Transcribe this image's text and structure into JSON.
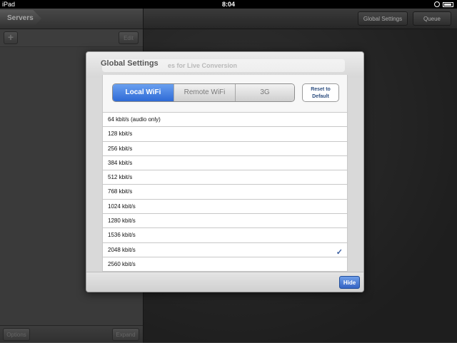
{
  "status_bar": {
    "device": "iPad",
    "time": "8:04",
    "icons": [
      "rotation-lock-icon",
      "battery-icon"
    ]
  },
  "left_pane": {
    "title": "Servers",
    "add_label": "+",
    "edit_label": "Edit",
    "options_label": "Options",
    "expand_label": "Expand"
  },
  "right_navbar": {
    "global_settings_label": "Global Settings",
    "queue_label": "Queue"
  },
  "modal": {
    "title": "Global Settings",
    "underlying_title": "es for Live Conversion",
    "segments": [
      "Local WiFi",
      "Remote WiFi",
      "3G"
    ],
    "selected_segment": "Local WiFi",
    "reset_label_line1": "Reset to",
    "reset_label_line2": "Default",
    "bitrates": [
      "64 kbit/s (audio only)",
      "128 kbit/s",
      "256 kbit/s",
      "384 kbit/s",
      "512 kbit/s",
      "768 kbit/s",
      "1024 kbit/s",
      "1280 kbit/s",
      "1536 kbit/s",
      "2048 kbit/s",
      "2560 kbit/s"
    ],
    "selected_bitrate": "2048 kbit/s",
    "check_mark": "✓",
    "hide_label": "Hide"
  },
  "colors": {
    "accent": "#2e6ad6",
    "check": "#3b5fa0"
  }
}
